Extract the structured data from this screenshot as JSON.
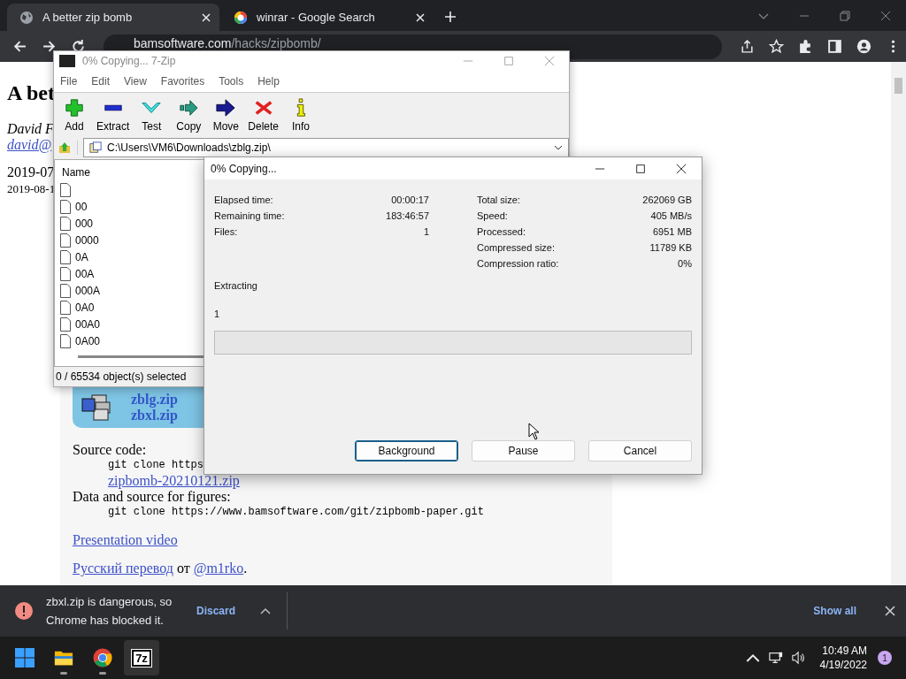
{
  "browser": {
    "tabs": [
      {
        "title": "A better zip bomb",
        "kind": "globe",
        "selected": true
      },
      {
        "title": "winrar - Google Search",
        "kind": "google",
        "selected": false
      }
    ],
    "address": {
      "domain": "bamsoftware.com",
      "path": "/hacks/zipbomb/"
    },
    "page": {
      "heading": "A bet",
      "author": "David F",
      "email": "david@",
      "date_1": "2019-07",
      "date_2": "2019-08-1",
      "download_links": [
        "zblg.zip",
        "zbxl.zip"
      ],
      "source_label": "Source code:",
      "git_command_1": "git clone https",
      "source_link": "zipbomb-20210121.zip",
      "figures_label": "Data and source for figures:",
      "git_command_2": "git clone https://www.bamsoftware.com/git/zipbomb-paper.git",
      "video_link": "Presentation video",
      "translation": {
        "link": "Русский перевод",
        "middle": " от ",
        "handle": "@m1rko",
        "end": "."
      }
    }
  },
  "sevenzip": {
    "title": "0% Copying... 7-Zip",
    "menu": [
      "File",
      "Edit",
      "View",
      "Favorites",
      "Tools",
      "Help"
    ],
    "toolbar": [
      {
        "label": "Add",
        "kind": "add"
      },
      {
        "label": "Extract",
        "kind": "extract"
      },
      {
        "label": "Test",
        "kind": "test"
      },
      {
        "label": "Copy",
        "kind": "copy"
      },
      {
        "label": "Move",
        "kind": "move"
      },
      {
        "label": "Delete",
        "kind": "delete"
      },
      {
        "label": "Info",
        "kind": "info"
      }
    ],
    "path": "C:\\Users\\VM6\\Downloads\\zblg.zip\\",
    "column": "Name",
    "files": [
      {
        "kind": "unnamed"
      },
      {
        "kind": "file",
        "name": "00"
      },
      {
        "kind": "file",
        "name": "000"
      },
      {
        "kind": "file",
        "name": "0000"
      },
      {
        "kind": "file",
        "name": "0A"
      },
      {
        "kind": "file",
        "name": "00A"
      },
      {
        "kind": "file",
        "name": "000A"
      },
      {
        "kind": "file",
        "name": "0A0"
      },
      {
        "kind": "file",
        "name": "00A0"
      },
      {
        "kind": "file",
        "name": "0A00"
      }
    ],
    "status": "0 / 65534 object(s) selected"
  },
  "dialog": {
    "title": "0% Copying...",
    "stats_left": [
      {
        "label": "Elapsed time:",
        "value": "00:00:17"
      },
      {
        "label": "Remaining time:",
        "value": "183:46:57"
      },
      {
        "label": "Files:",
        "value": "1"
      }
    ],
    "stats_right": [
      {
        "label": "Total size:",
        "value": "262069 GB"
      },
      {
        "label": "Speed:",
        "value": "405 MB/s"
      },
      {
        "label": "Processed:",
        "value": "6951 MB"
      },
      {
        "label": "Compressed size:",
        "value": "11789 KB"
      },
      {
        "label": "Compression ratio:",
        "value": "0%"
      }
    ],
    "operation": "Extracting",
    "current": "1",
    "progress": {
      "level": 0
    },
    "buttons": [
      {
        "label": "Background",
        "focused": true
      },
      {
        "label": "Pause",
        "focused": false
      },
      {
        "label": "Cancel",
        "focused": false
      }
    ]
  },
  "download_bar": {
    "message": "zbxl.zip is dangerous, so Chrome has blocked it.",
    "discard": "Discard",
    "show_all": "Show all"
  },
  "taskbar": {
    "apps": [
      {
        "kind": "start",
        "running": false,
        "active": false
      },
      {
        "kind": "explorer",
        "running": true,
        "active": false
      },
      {
        "kind": "chrome",
        "running": true,
        "active": false
      },
      {
        "kind": "sevenzip",
        "label": "7z",
        "running": false,
        "active": true
      }
    ],
    "time": "10:49 AM",
    "date": "4/19/2022",
    "notifications": "1"
  }
}
